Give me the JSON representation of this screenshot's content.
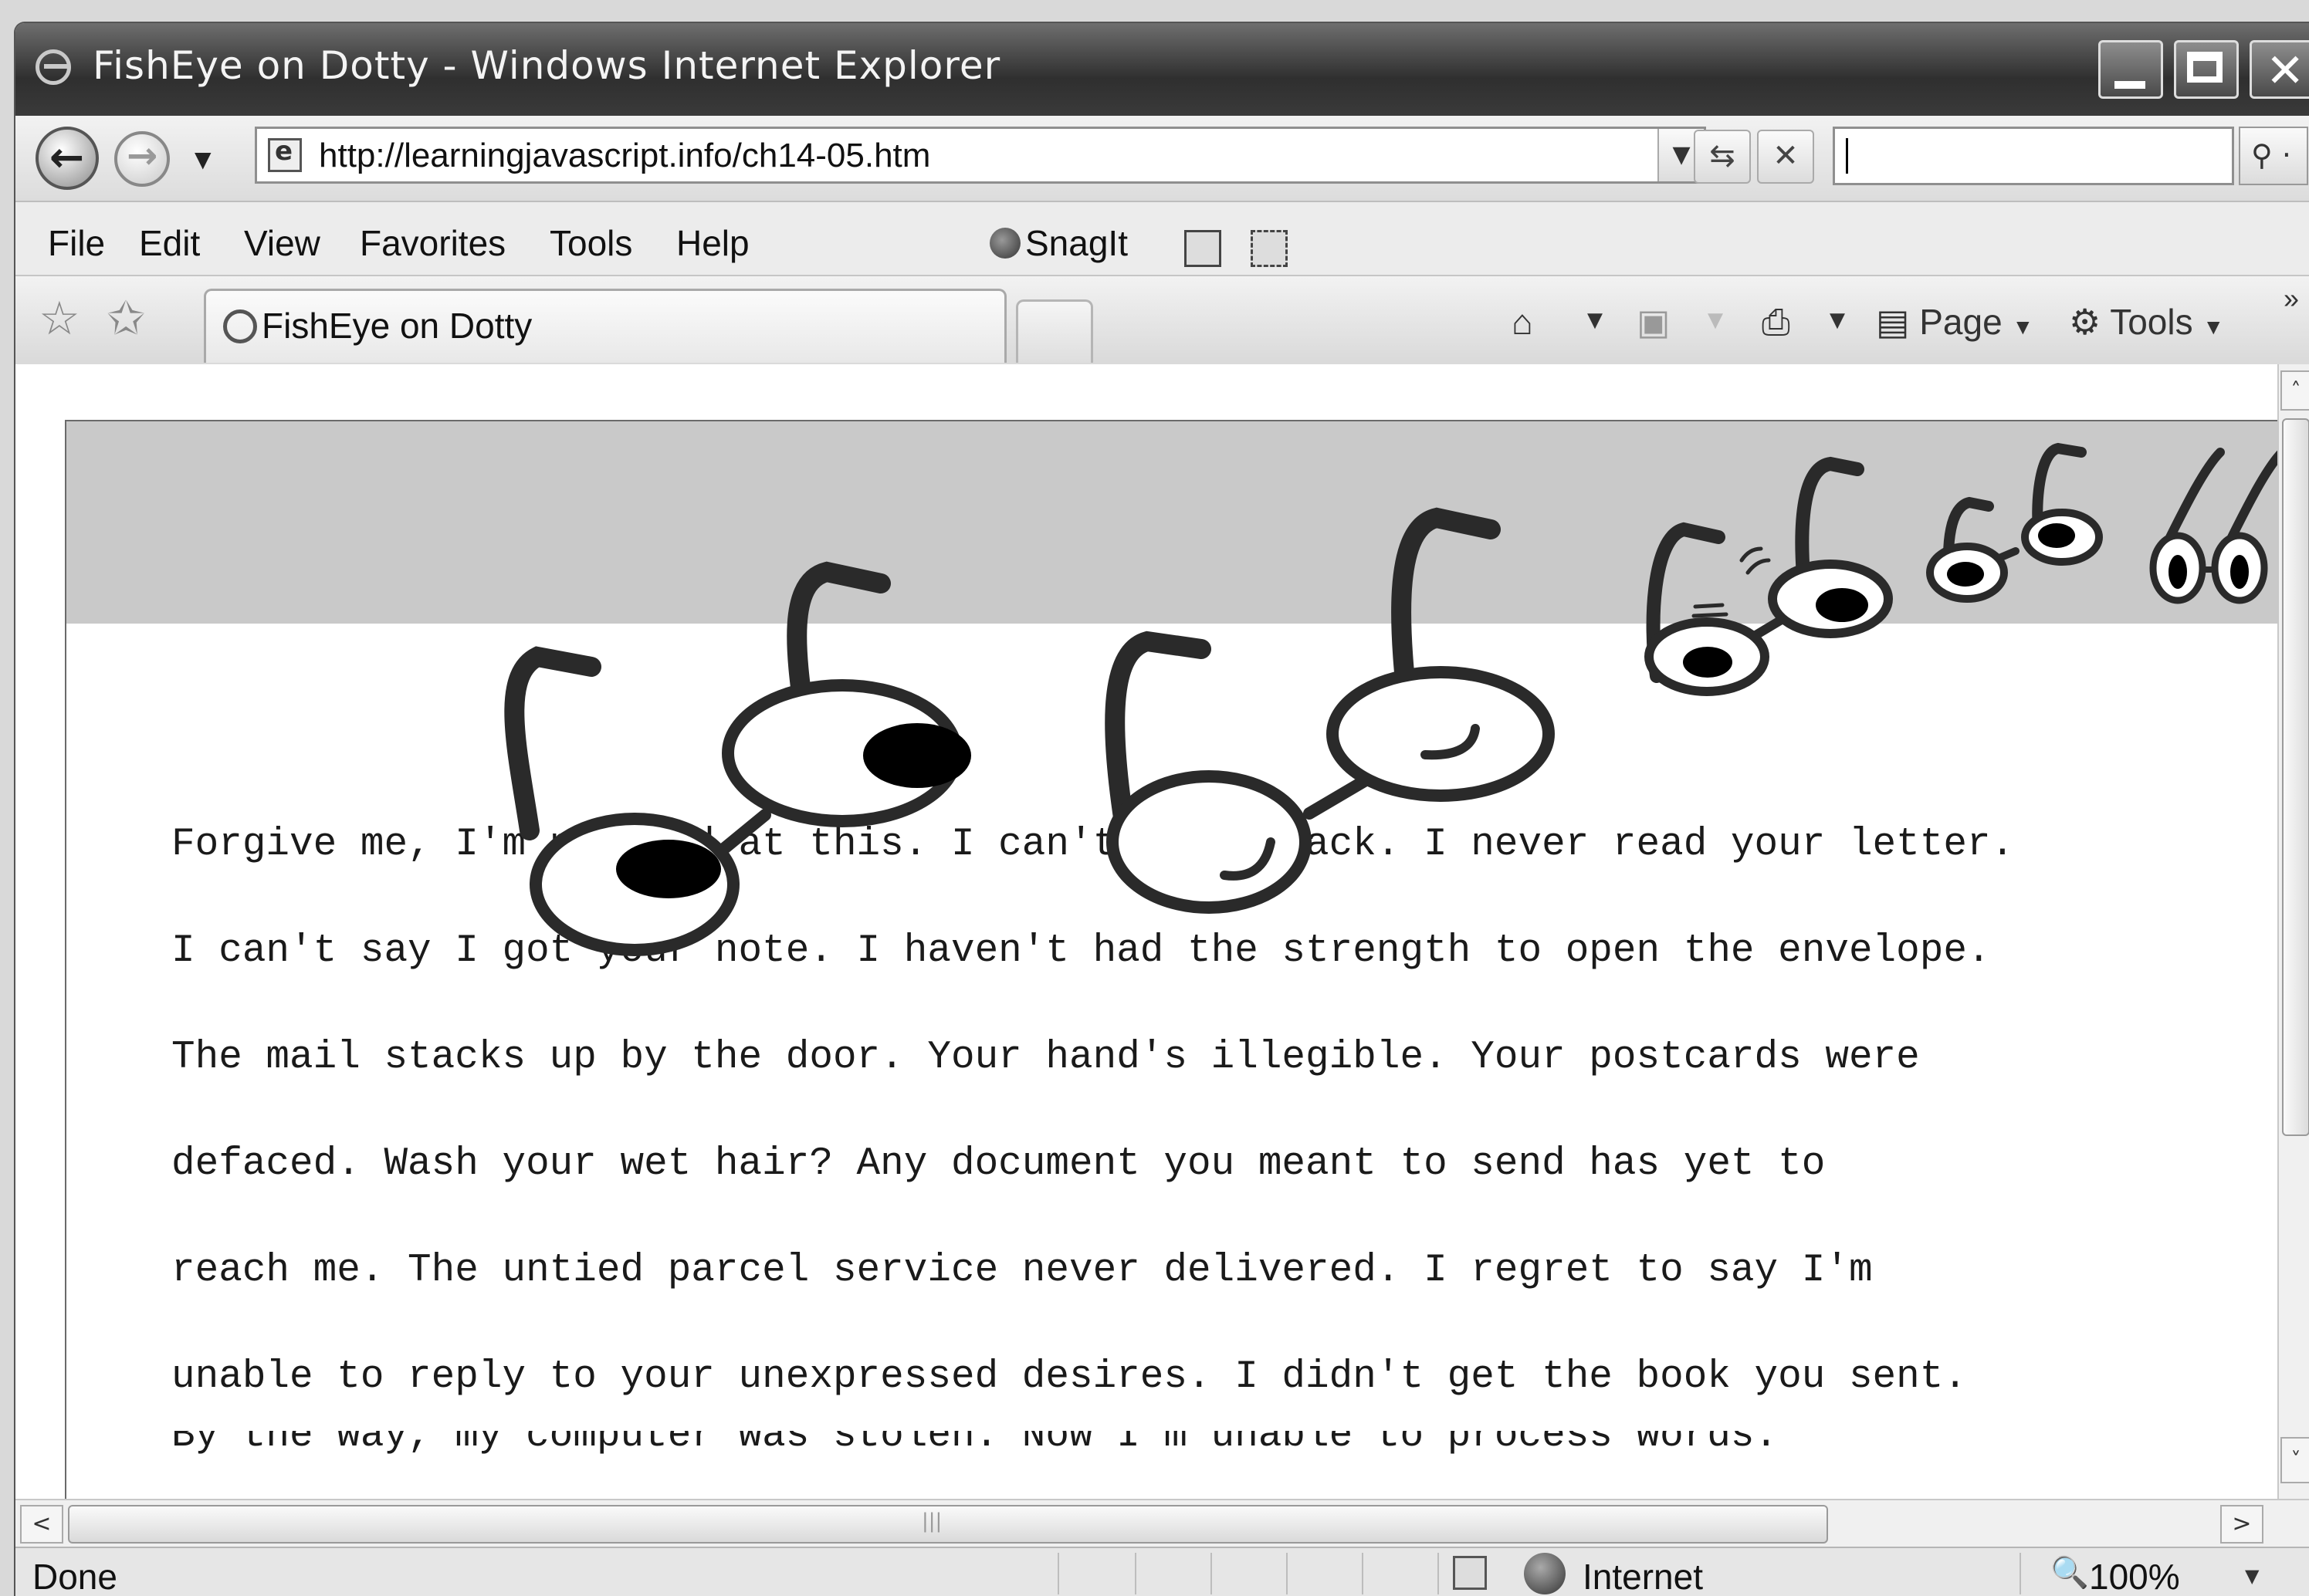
{
  "window": {
    "title": "FishEye on Dotty - Windows Internet Explorer"
  },
  "address_bar": {
    "url": "http://learningjavascript.info/ch14-05.htm",
    "search_value": ""
  },
  "menu_bar": {
    "items": [
      "File",
      "Edit",
      "View",
      "Favorites",
      "Tools",
      "Help"
    ],
    "snagit_label": "SnagIt"
  },
  "tab_bar": {
    "tab_title": "FishEye on Dotty",
    "page_menu": "Page",
    "tools_menu": "Tools"
  },
  "page": {
    "poem_lines": [
      "Forgive me, I'm no good at this. I can't write back. I never read your letter.",
      "I can't say I got your note. I haven't had the strength to open the envelope.",
      "The mail stacks up by the door. Your hand's illegible. Your postcards were",
      "defaced. Wash your wet hair? Any document you meant to send has yet to",
      "reach me. The untied parcel service never delivered. I regret to say I'm",
      "unable to reply to your unexpressed desires. I didn't get the book you sent.",
      "By the way, my computer was stolen. Now I'm unable to process words."
    ]
  },
  "status_bar": {
    "status": "Done",
    "zone": "Internet",
    "zoom": "100%"
  },
  "icons": [
    "ie-logo-icon",
    "back-arrow-icon",
    "forward-arrow-icon",
    "page-icon",
    "refresh-icon",
    "stop-icon",
    "search-icon",
    "snagit-icon",
    "favorites-star-icon",
    "add-favorite-icon",
    "home-icon",
    "feeds-icon",
    "print-icon",
    "page-icon",
    "gear-icon",
    "glasses-icon",
    "globe-icon",
    "zoom-icon"
  ]
}
